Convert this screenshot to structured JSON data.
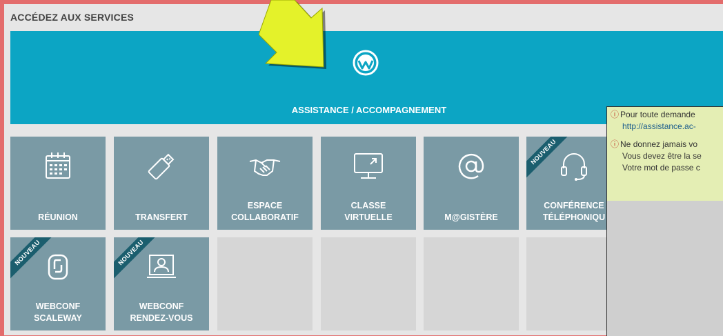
{
  "section_title": "ACCÉDEZ AUX SERVICES",
  "hero": {
    "label": "ASSISTANCE / ACCOMPAGNEMENT",
    "color": "#0ca5c4"
  },
  "tiles": [
    {
      "label": "RÉUNION",
      "icon": "calendar-icon",
      "badge": ""
    },
    {
      "label": "TRANSFERT",
      "icon": "usb-key-icon",
      "badge": ""
    },
    {
      "label": "ESPACE\nCOLLABORATIF",
      "icon": "handshake-icon",
      "badge": ""
    },
    {
      "label": "CLASSE\nVIRTUELLE",
      "icon": "screen-icon",
      "badge": ""
    },
    {
      "label": "M@GISTÈRE",
      "icon": "at-sign-icon",
      "badge": ""
    },
    {
      "label": "CONFÉRENCE\nTÉLÉPHONIQU",
      "icon": "headset-icon",
      "badge": "NOUVEAU"
    },
    {
      "label": "WEBCONF\nSCALEWAY",
      "icon": "scaleway-icon",
      "badge": "NOUVEAU"
    },
    {
      "label": "WEBCONF\nRENDEZ-VOUS",
      "icon": "video-user-icon",
      "badge": "NOUVEAU"
    }
  ],
  "popup": {
    "msg1_line1": "Pour toute demande",
    "msg1_link": "http://assistance.ac-",
    "msg2_line1": "Ne donnez jamais vo",
    "msg2_line2": "Vous devez être la se",
    "msg2_line3": "Votre mot de passe c"
  },
  "colors": {
    "tile": "#7a9aa5",
    "ribbon": "#1b5e6e",
    "arrow": "#e4f22a",
    "frame": "#e36c6c"
  }
}
